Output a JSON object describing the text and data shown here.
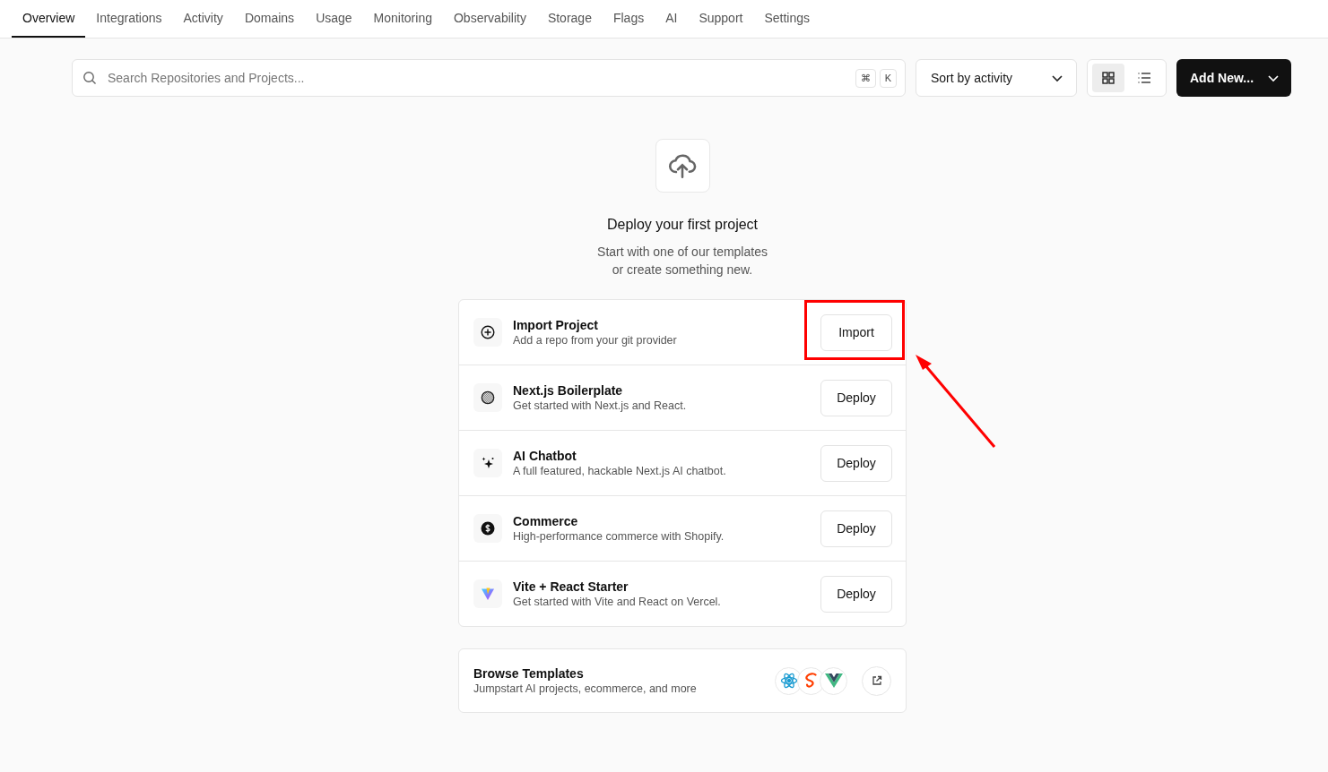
{
  "tabs": [
    {
      "label": "Overview",
      "selected": true
    },
    {
      "label": "Integrations",
      "selected": false
    },
    {
      "label": "Activity",
      "selected": false
    },
    {
      "label": "Domains",
      "selected": false
    },
    {
      "label": "Usage",
      "selected": false
    },
    {
      "label": "Monitoring",
      "selected": false
    },
    {
      "label": "Observability",
      "selected": false
    },
    {
      "label": "Storage",
      "selected": false
    },
    {
      "label": "Flags",
      "selected": false
    },
    {
      "label": "AI",
      "selected": false
    },
    {
      "label": "Support",
      "selected": false
    },
    {
      "label": "Settings",
      "selected": false
    }
  ],
  "search": {
    "placeholder": "Search Repositories and Projects...",
    "shortcut": [
      "⌘",
      "K"
    ]
  },
  "sort": {
    "value": "Sort by activity"
  },
  "views": [
    {
      "kind": "grid",
      "selected": true
    },
    {
      "kind": "list",
      "selected": false
    }
  ],
  "add_button": "Add New...",
  "empty_state": {
    "title": "Deploy your first project",
    "subtitle_lines": [
      "Start with one of our templates",
      "or create something new."
    ]
  },
  "items": [
    {
      "kind": "import",
      "title": "Import Project",
      "description": "Add a repo from your git provider",
      "button": "Import",
      "highlighted": true
    },
    {
      "kind": "nextjs",
      "title": "Next.js Boilerplate",
      "description": "Get started with Next.js and React.",
      "button": "Deploy",
      "highlighted": false
    },
    {
      "kind": "ai",
      "title": "AI Chatbot",
      "description": "A full featured, hackable Next.js AI chatbot.",
      "button": "Deploy",
      "highlighted": false
    },
    {
      "kind": "commerce",
      "title": "Commerce",
      "description": "High-performance commerce with Shopify.",
      "button": "Deploy",
      "highlighted": false
    },
    {
      "kind": "vite",
      "title": "Vite + React Starter",
      "description": "Get started with Vite and React on Vercel.",
      "button": "Deploy",
      "highlighted": false
    }
  ],
  "browse": {
    "title": "Browse Templates",
    "description": "Jumpstart AI projects, ecommerce, and more"
  }
}
